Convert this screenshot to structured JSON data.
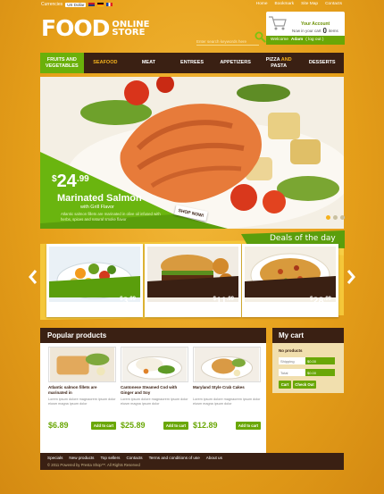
{
  "header": {
    "currencies_label": "Currencies",
    "currency_selected": "US Dollar",
    "top_links": [
      "Home",
      "Bookmark",
      "Site Map",
      "Contacts"
    ],
    "logo_big": "FOOD",
    "logo_small_1": "ONLINE",
    "logo_small_2": "STORE",
    "search_placeholder": "Enter search keywords here",
    "account_title": "Your Account",
    "cart_text_1": "Now in your cart",
    "cart_count": "0",
    "cart_text_2": "items",
    "welcome": "Welcome",
    "user": "Adam",
    "logout": "( log out )"
  },
  "nav": {
    "items": [
      {
        "label_1": "FRUITS AND",
        "label_2": "VEGETABLES"
      },
      {
        "label_1": "SEAFOOD",
        "label_2": ""
      },
      {
        "label_1": "MEAT",
        "label_2": ""
      },
      {
        "label_1": "ENTREES",
        "label_2": ""
      },
      {
        "label_1": "APPETIZERS",
        "label_2": ""
      },
      {
        "label_1": "PIZZA",
        "label_hl": "AND",
        "label_2": "PASTA"
      },
      {
        "label_1": "DESSERTS",
        "label_2": ""
      }
    ]
  },
  "hero": {
    "currency": "$",
    "price_main": "24",
    "price_cents": ".99",
    "title": "Marinated Salmon",
    "subtitle": "with Grill Flavor",
    "description": "Atlantic salmon fillets are marinated in olive oil infused with herbs, spices and natural smoke flavor",
    "shop_now": "SHOP NOW!"
  },
  "deals": {
    "title": "Deals of the day",
    "items": [
      {
        "currency": "$",
        "price": "3",
        "cents": ".99",
        "name": "Mediterranean Vegetable Blend"
      },
      {
        "currency": "$",
        "price": "11",
        "cents": ".99",
        "name": "Quarter Pound Beef Patties"
      },
      {
        "currency": "$",
        "price": "28",
        "cents": ".99",
        "name": "Breaded Flounder"
      }
    ]
  },
  "popular": {
    "title": "Popular products",
    "add_label": "Add to cart",
    "items": [
      {
        "title": "Atlantic salmon fillets are marinated in",
        "desc": "Lorem ipsum dolore magnaorem ipsum dolor eiusm magna ipsum dolor",
        "price": "$6.89"
      },
      {
        "title": "Cantonese Steamed Cod with Ginger and Soy",
        "desc": "Lorem ipsum dolore magnaorem ipsum dolor eiusm magna ipsum dolor",
        "price": "$25.89"
      },
      {
        "title": "Maryland Style Crab Cakes",
        "desc": "Lorem ipsum dolore magnaorem ipsum dolor eiusm magna ipsum dolor",
        "price": "$12.89"
      }
    ]
  },
  "cart": {
    "title": "My cart",
    "no_products": "No products",
    "shipping_label": "Shipping",
    "shipping_value": "$0.00",
    "total_label": "Total",
    "total_value": "$0.00",
    "cart_button": "Cart",
    "checkout_button": "Check Out"
  },
  "footer": {
    "links": [
      "Specials",
      "New products",
      "Top sellers",
      "Contacts",
      "Terms and conditions of use",
      "About us"
    ],
    "copyright": "© 2011 Powered by Presta Shop™. All Rights Reserved"
  },
  "colors": {
    "background": "#e8a21b",
    "brown": "#3a2013",
    "green": "#6aa707",
    "accent": "#f5b21e"
  }
}
